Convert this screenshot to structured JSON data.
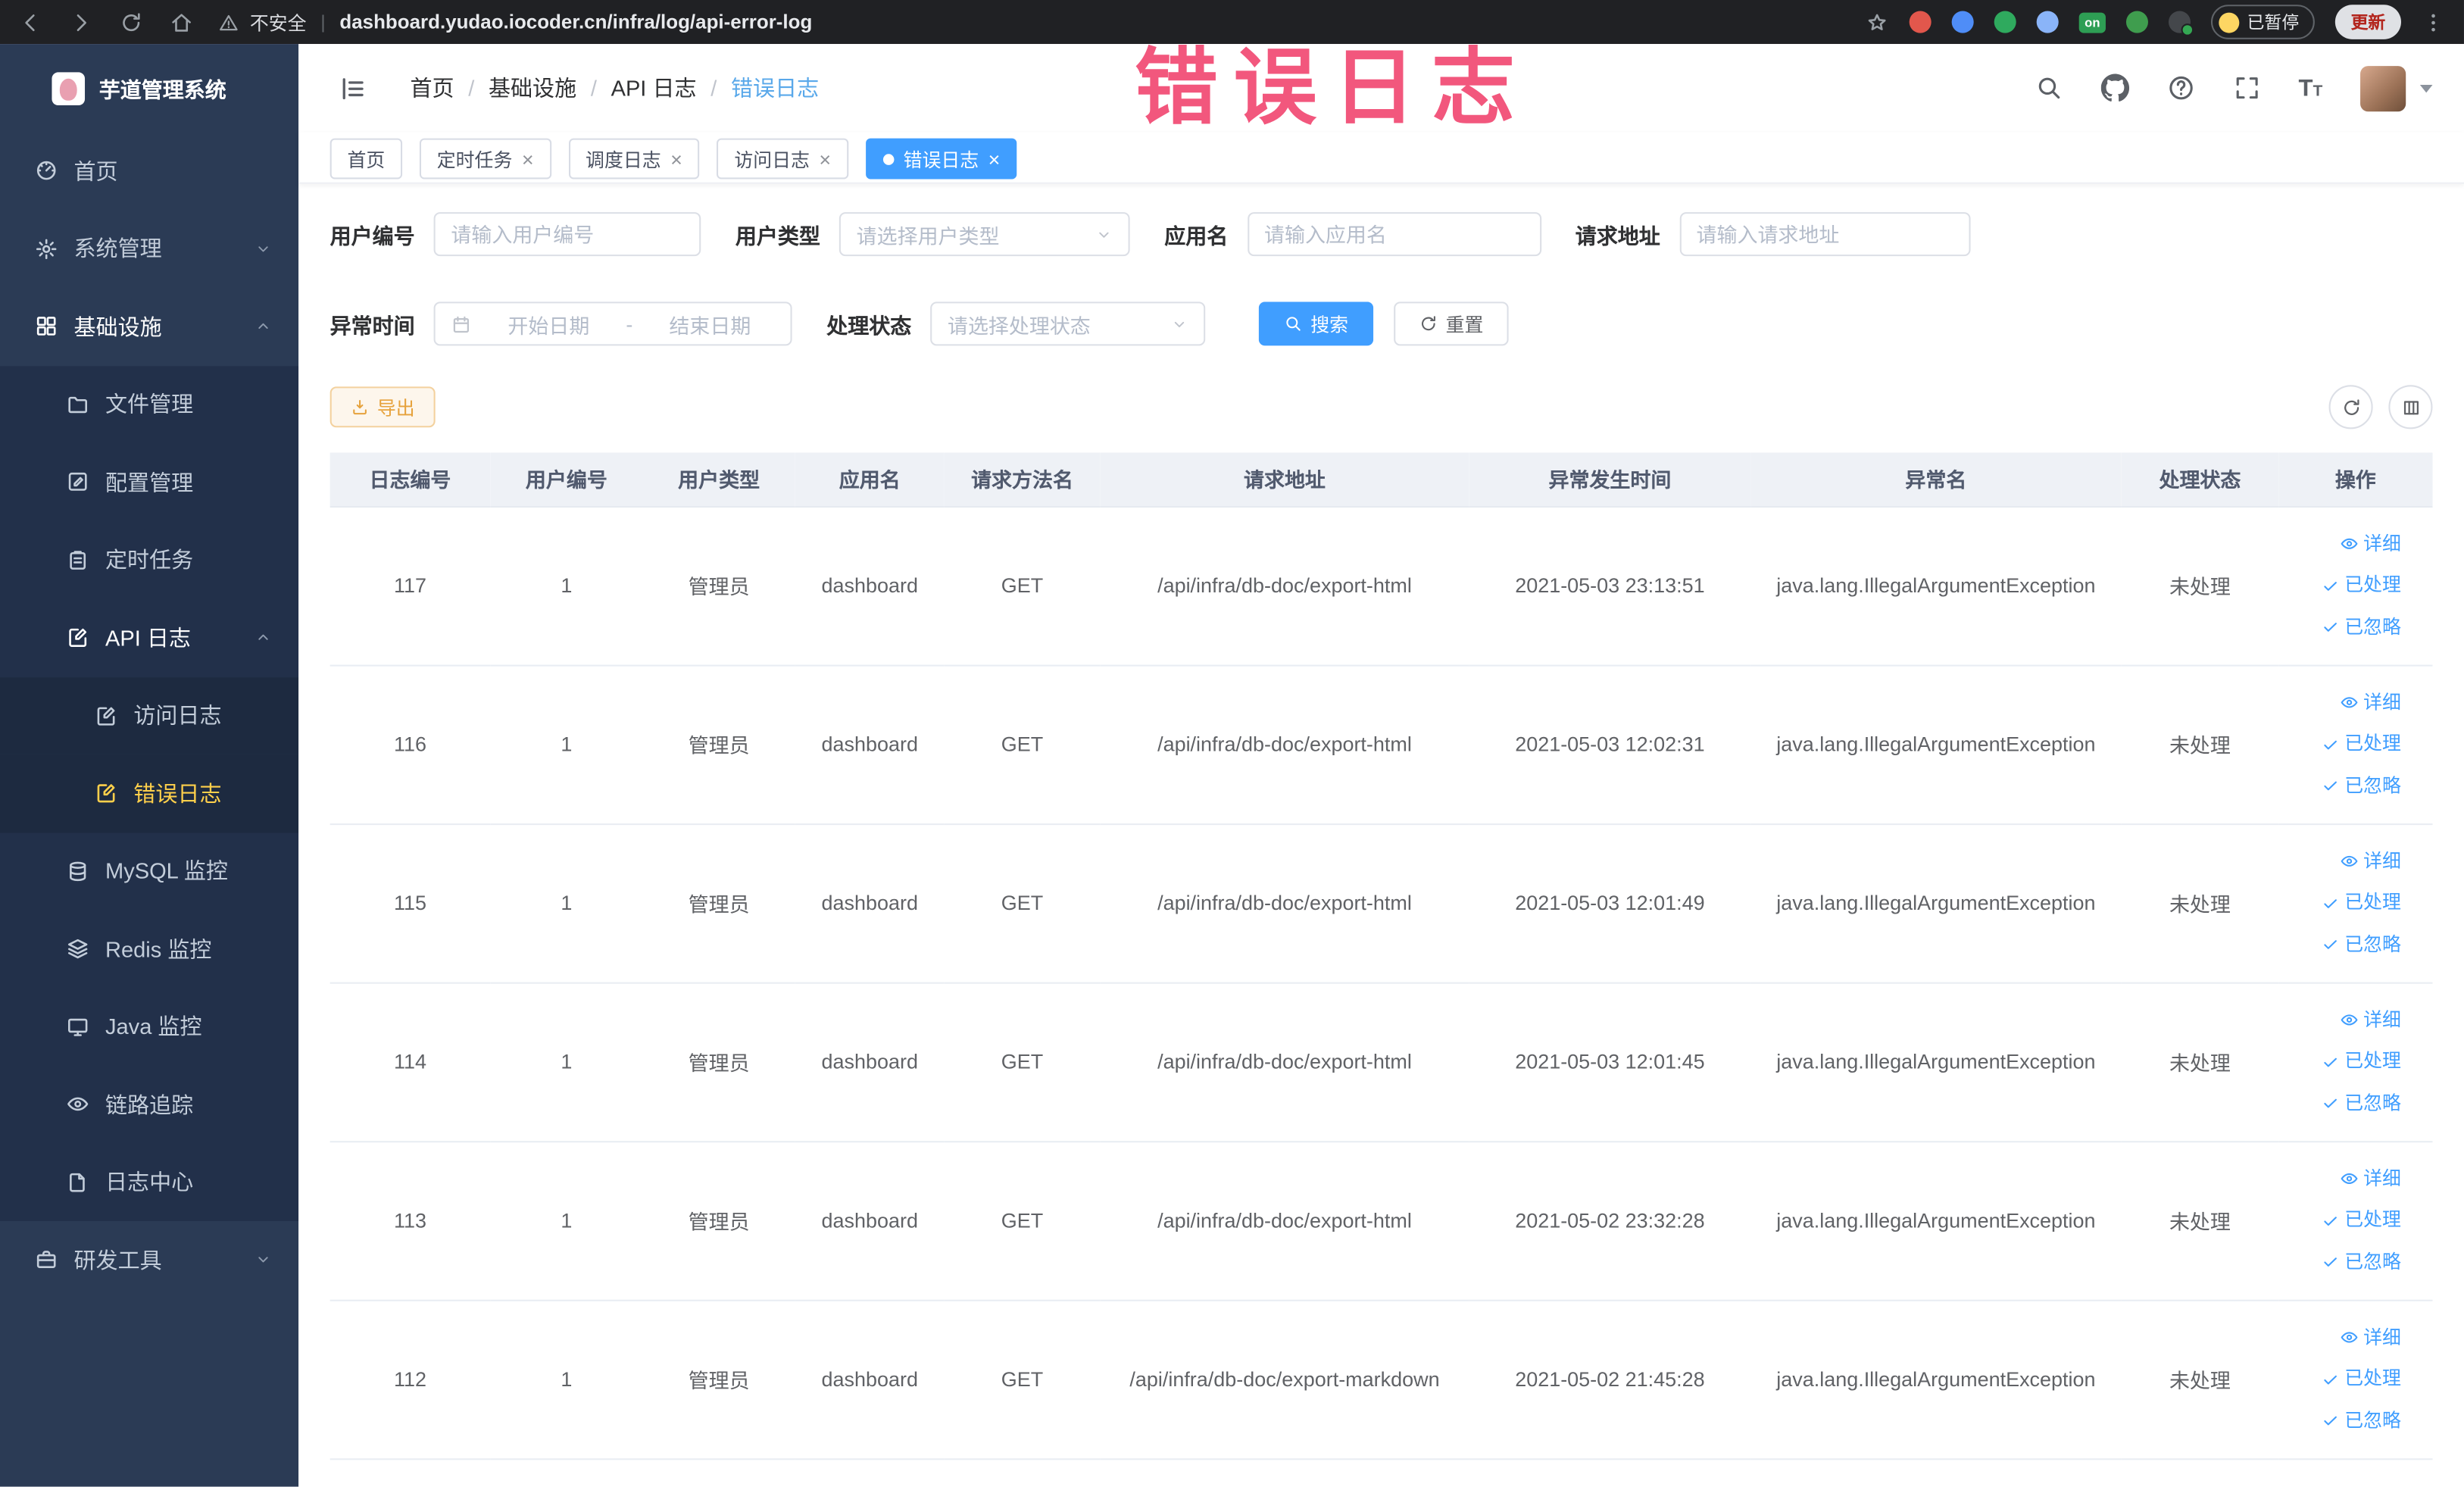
{
  "colors": {
    "primary": "#409eff",
    "warning": "#e6a23c",
    "sidebar_active": "#ffd04b",
    "annotation": "#f2577d"
  },
  "browser": {
    "security_label": "不安全",
    "url": "dashboard.yudao.iocoder.cn/infra/log/api-error-log",
    "extension_badge": "on",
    "paused_label": "已暂停",
    "update_label": "更新"
  },
  "overlay": {
    "title": "错误日志"
  },
  "sidebar": {
    "logo_title": "芋道管理系统",
    "items": [
      {
        "label": "首页",
        "icon": "dashboard",
        "level": 1,
        "expandable": false,
        "open": false,
        "active": false,
        "trail": false
      },
      {
        "label": "系统管理",
        "icon": "gear",
        "level": 1,
        "expandable": true,
        "open": false,
        "active": false,
        "trail": false
      },
      {
        "label": "基础设施",
        "icon": "grid",
        "level": 1,
        "expandable": true,
        "open": true,
        "active": false,
        "trail": true
      },
      {
        "label": "文件管理",
        "icon": "folder",
        "level": 2,
        "expandable": false,
        "open": false,
        "active": false,
        "trail": false
      },
      {
        "label": "配置管理",
        "icon": "edit",
        "level": 2,
        "expandable": false,
        "open": false,
        "active": false,
        "trail": false
      },
      {
        "label": "定时任务",
        "icon": "clipboard",
        "level": 2,
        "expandable": false,
        "open": false,
        "active": false,
        "trail": false
      },
      {
        "label": "API 日志",
        "icon": "docpen",
        "level": 2,
        "expandable": true,
        "open": true,
        "active": false,
        "trail": true
      },
      {
        "label": "访问日志",
        "icon": "docpen",
        "level": 3,
        "expandable": false,
        "open": false,
        "active": false,
        "trail": false
      },
      {
        "label": "错误日志",
        "icon": "docpen",
        "level": 3,
        "expandable": false,
        "open": false,
        "active": true,
        "trail": false
      },
      {
        "label": "MySQL 监控",
        "icon": "db",
        "level": 2,
        "expandable": false,
        "open": false,
        "active": false,
        "trail": false
      },
      {
        "label": "Redis 监控",
        "icon": "layers",
        "level": 2,
        "expandable": false,
        "open": false,
        "active": false,
        "trail": false
      },
      {
        "label": "Java 监控",
        "icon": "monitor",
        "level": 2,
        "expandable": false,
        "open": false,
        "active": false,
        "trail": false
      },
      {
        "label": "链路追踪",
        "icon": "eye",
        "level": 2,
        "expandable": false,
        "open": false,
        "active": false,
        "trail": false
      },
      {
        "label": "日志中心",
        "icon": "doc",
        "level": 2,
        "expandable": false,
        "open": false,
        "active": false,
        "trail": false
      },
      {
        "label": "研发工具",
        "icon": "briefcase",
        "level": 1,
        "expandable": true,
        "open": false,
        "active": false,
        "trail": false
      }
    ]
  },
  "header": {
    "breadcrumb": [
      "首页",
      "基础设施",
      "API 日志",
      "错误日志"
    ]
  },
  "tabs": [
    {
      "label": "首页",
      "closable": false,
      "active": false
    },
    {
      "label": "定时任务",
      "closable": true,
      "active": false
    },
    {
      "label": "调度日志",
      "closable": true,
      "active": false
    },
    {
      "label": "访问日志",
      "closable": true,
      "active": false
    },
    {
      "label": "错误日志",
      "closable": true,
      "active": true
    }
  ],
  "filters": {
    "user_id": {
      "label": "用户编号",
      "placeholder": "请输入用户编号",
      "value": ""
    },
    "user_type": {
      "label": "用户类型",
      "placeholder": "请选择用户类型"
    },
    "app_name": {
      "label": "应用名",
      "placeholder": "请输入应用名",
      "value": ""
    },
    "request_url": {
      "label": "请求地址",
      "placeholder": "请输入请求地址",
      "value": ""
    },
    "exception_time": {
      "label": "异常时间",
      "start_placeholder": "开始日期",
      "separator": "-",
      "end_placeholder": "结束日期"
    },
    "process_status": {
      "label": "处理状态",
      "placeholder": "请选择处理状态"
    },
    "search_label": "搜索",
    "reset_label": "重置"
  },
  "toolbar": {
    "export_label": "导出"
  },
  "table": {
    "columns": [
      "日志编号",
      "用户编号",
      "用户类型",
      "应用名",
      "请求方法名",
      "请求地址",
      "异常发生时间",
      "异常名",
      "处理状态",
      "操作"
    ],
    "row_actions": [
      "详细",
      "已处理",
      "已忽略"
    ],
    "rows": [
      {
        "id": "117",
        "user_id": "1",
        "user_type": "管理员",
        "app_name": "dashboard",
        "method": "GET",
        "url": "/api/infra/db-doc/export-html",
        "time": "2021-05-03 23:13:51",
        "exception": "java.lang.IllegalArgumentException",
        "status": "未处理"
      },
      {
        "id": "116",
        "user_id": "1",
        "user_type": "管理员",
        "app_name": "dashboard",
        "method": "GET",
        "url": "/api/infra/db-doc/export-html",
        "time": "2021-05-03 12:02:31",
        "exception": "java.lang.IllegalArgumentException",
        "status": "未处理"
      },
      {
        "id": "115",
        "user_id": "1",
        "user_type": "管理员",
        "app_name": "dashboard",
        "method": "GET",
        "url": "/api/infra/db-doc/export-html",
        "time": "2021-05-03 12:01:49",
        "exception": "java.lang.IllegalArgumentException",
        "status": "未处理"
      },
      {
        "id": "114",
        "user_id": "1",
        "user_type": "管理员",
        "app_name": "dashboard",
        "method": "GET",
        "url": "/api/infra/db-doc/export-html",
        "time": "2021-05-03 12:01:45",
        "exception": "java.lang.IllegalArgumentException",
        "status": "未处理"
      },
      {
        "id": "113",
        "user_id": "1",
        "user_type": "管理员",
        "app_name": "dashboard",
        "method": "GET",
        "url": "/api/infra/db-doc/export-html",
        "time": "2021-05-02 23:32:28",
        "exception": "java.lang.IllegalArgumentException",
        "status": "未处理"
      },
      {
        "id": "112",
        "user_id": "1",
        "user_type": "管理员",
        "app_name": "dashboard",
        "method": "GET",
        "url": "/api/infra/db-doc/export-markdown",
        "time": "2021-05-02 21:45:28",
        "exception": "java.lang.IllegalArgumentException",
        "status": "未处理"
      }
    ]
  }
}
